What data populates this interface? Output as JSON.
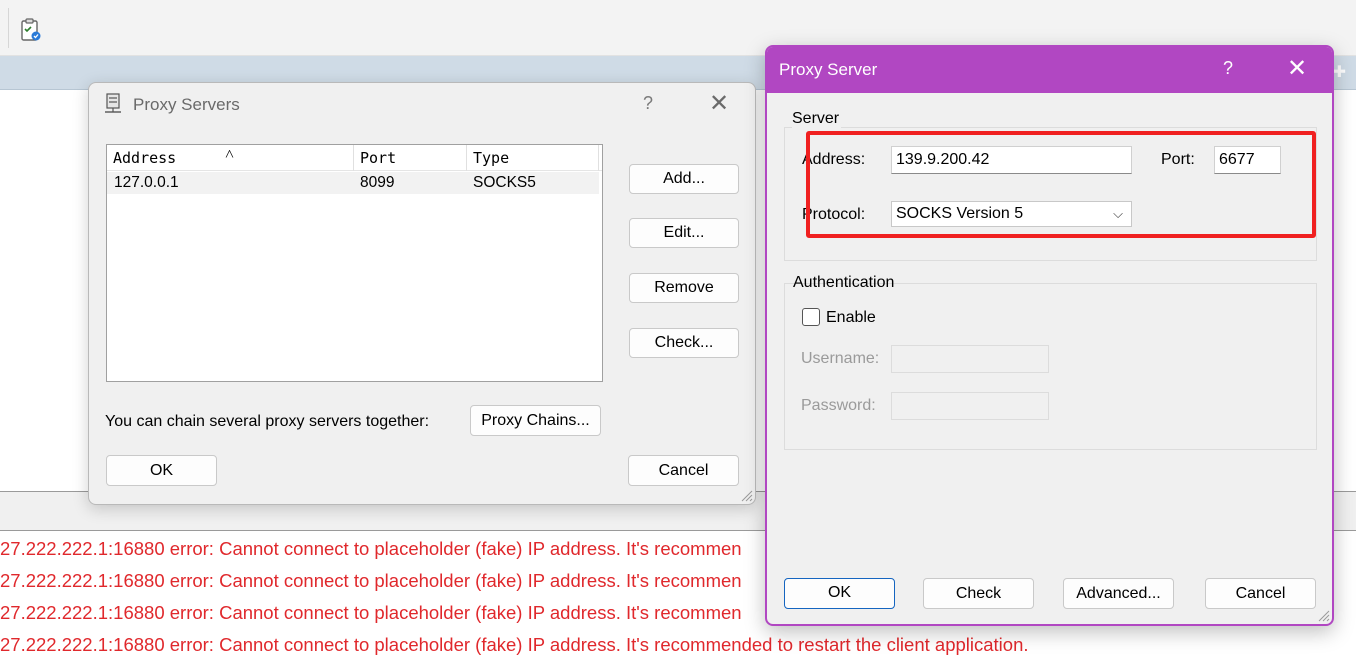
{
  "toolbar": {
    "icon": "clipboard-check-icon"
  },
  "header": {
    "icon": "pin-icon",
    "glyph": "✚"
  },
  "log": {
    "lines": [
      "27.222.222.1:16880 error: Cannot connect to placeholder (fake) IP address. It's recommen",
      "27.222.222.1:16880 error: Cannot connect to placeholder (fake) IP address. It's recommen",
      "27.222.222.1:16880 error: Cannot connect to placeholder (fake) IP address. It's recommen",
      "27.222.222.1:16880 error: Cannot connect to placeholder (fake) IP address. It's recommended to restart the client application."
    ],
    "color": "#e0282c"
  },
  "proxy_servers": {
    "title": "Proxy Servers",
    "help": "?",
    "close": "✕",
    "columns": [
      "Address",
      "Port",
      "Type"
    ],
    "sort_indicator": "˄",
    "rows": [
      {
        "address": "127.0.0.1",
        "port": "8099",
        "type": "SOCKS5"
      }
    ],
    "buttons": {
      "add": "Add...",
      "edit": "Edit...",
      "remove": "Remove",
      "check": "Check..."
    },
    "chain_label": "You can chain several proxy servers together:",
    "proxy_chains": "Proxy Chains...",
    "ok": "OK",
    "cancel": "Cancel"
  },
  "proxy_server": {
    "title": "Proxy Server",
    "help": "?",
    "close": "✕",
    "accent": "#b147c2",
    "server_group": "Server",
    "address_label": "Address:",
    "address_value": "139.9.200.42",
    "port_label": "Port:",
    "port_value": "6677",
    "protocol_label": "Protocol:",
    "protocol_value": "SOCKS Version 5",
    "auth_group": "Authentication",
    "enable_label": "Enable",
    "enable_checked": false,
    "username_label": "Username:",
    "password_label": "Password:",
    "highlight_color": "#f02020",
    "buttons": {
      "ok": "OK",
      "check": "Check",
      "advanced": "Advanced...",
      "cancel": "Cancel"
    }
  }
}
